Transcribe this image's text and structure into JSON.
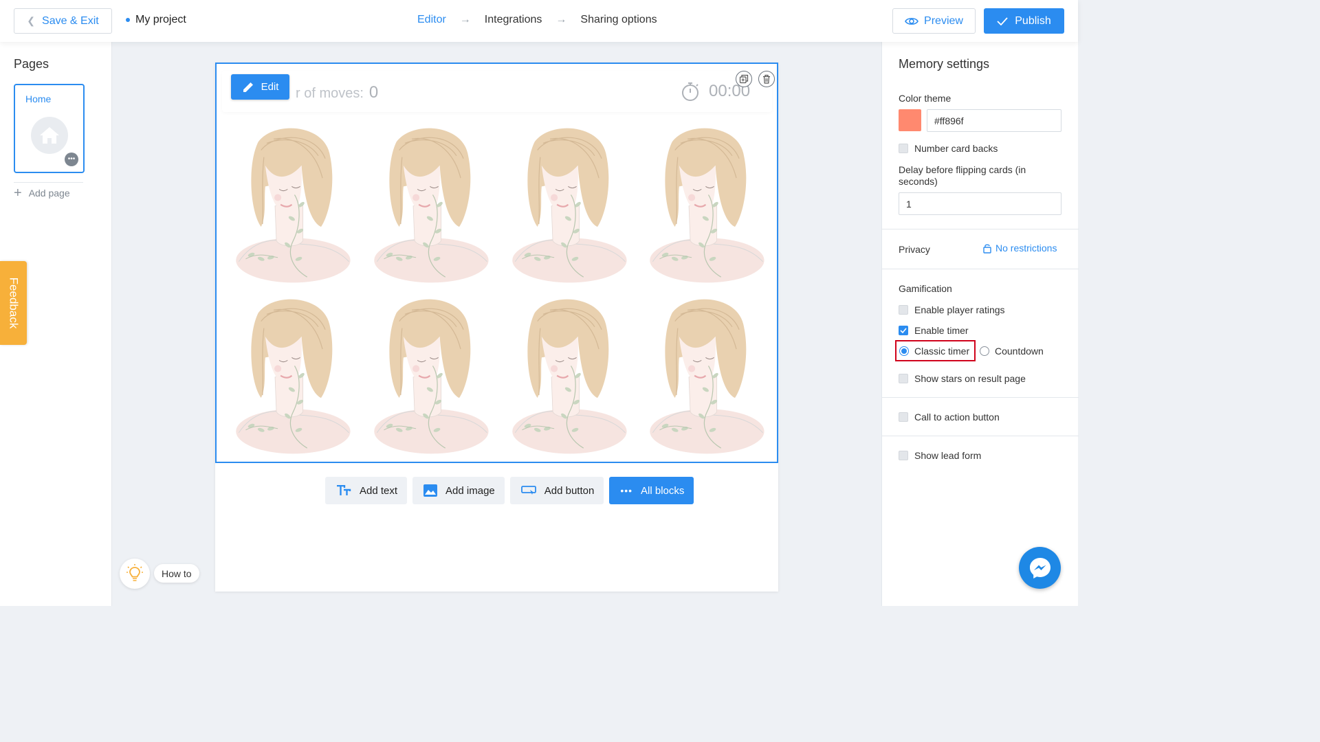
{
  "header": {
    "save_exit_label": "Save & Exit",
    "project_name": "My project",
    "steps": [
      "Editor",
      "Integrations",
      "Sharing options"
    ],
    "preview_label": "Preview",
    "publish_label": "Publish"
  },
  "pages_panel": {
    "title": "Pages",
    "pages": [
      {
        "label": "Home"
      }
    ],
    "add_page_label": "Add page"
  },
  "feedback_label": "Feedback",
  "howto_label": "How to",
  "game": {
    "edit_label": "Edit",
    "moves_label": "r of moves:",
    "moves_value": "0",
    "timer_value": "00:00",
    "card_count": 8
  },
  "add_blocks": {
    "add_text": "Add text",
    "add_image": "Add image",
    "add_button": "Add button",
    "all_blocks": "All blocks"
  },
  "settings": {
    "title": "Memory settings",
    "color_theme_label": "Color theme",
    "color_theme_value": "#ff896f",
    "number_card_backs_label": "Number card backs",
    "number_card_backs_checked": false,
    "delay_label": "Delay before flipping cards (in seconds)",
    "delay_value": "1",
    "privacy_label": "Privacy",
    "privacy_value": "No restrictions",
    "gamification_label": "Gamification",
    "enable_player_ratings_label": "Enable player ratings",
    "enable_player_ratings_checked": false,
    "enable_timer_label": "Enable timer",
    "enable_timer_checked": true,
    "timer_modes": {
      "classic": "Classic timer",
      "countdown": "Countdown",
      "selected": "classic"
    },
    "show_stars_label": "Show stars on result page",
    "show_stars_checked": false,
    "cta_button_label": "Call to action button",
    "cta_button_checked": false,
    "lead_form_label": "Show lead form",
    "lead_form_checked": false
  },
  "colors": {
    "accent": "#2b8cf0",
    "feedback": "#f7b03a",
    "highlight": "#d0021b",
    "theme_swatch": "#ff896f"
  }
}
